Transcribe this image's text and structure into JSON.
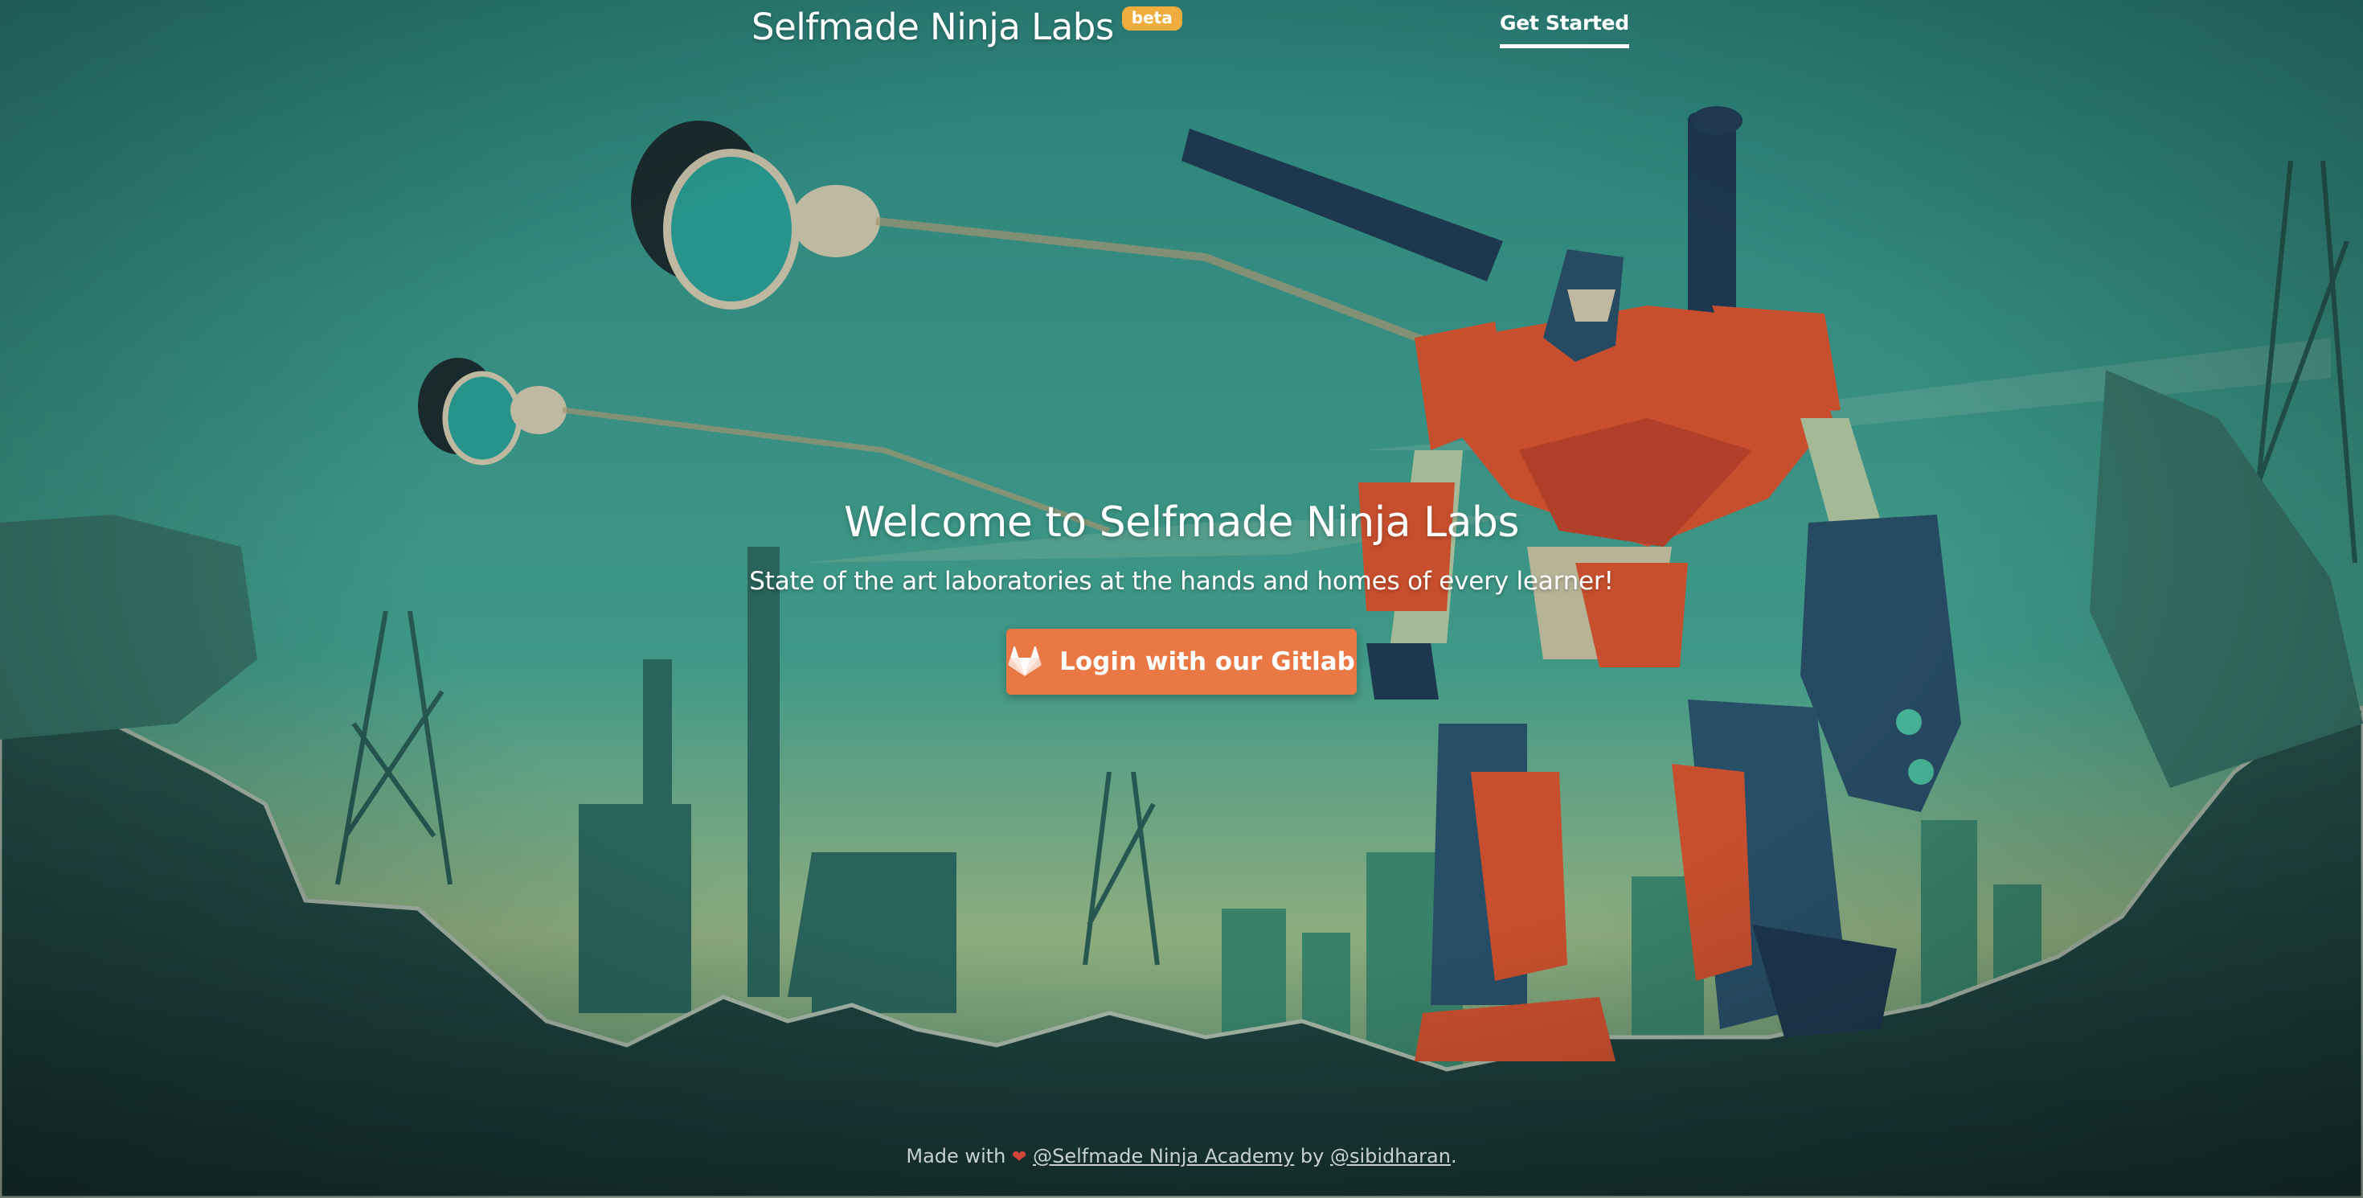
{
  "header": {
    "brand_title": "Selfmade Ninja Labs",
    "beta_label": "beta",
    "nav_get_started": "Get Started"
  },
  "hero": {
    "title": "Welcome to Selfmade Ninja Labs",
    "subtitle": "State of the art laboratories at the hands and homes of every learner!",
    "login_button_label": "Login with our Gitlab",
    "login_button_icon": "gitlab-icon"
  },
  "footer": {
    "made_with": "Made with",
    "heart_icon": "heart-icon",
    "academy_link": "@Selfmade Ninja Academy",
    "by": "by",
    "author_link": "@sibidharan",
    "period": "."
  },
  "colors": {
    "accent_button": "#e97844",
    "beta_badge": "#f0ad3f",
    "sky": "#3a9c8e",
    "ground": "#1d3f3c"
  }
}
